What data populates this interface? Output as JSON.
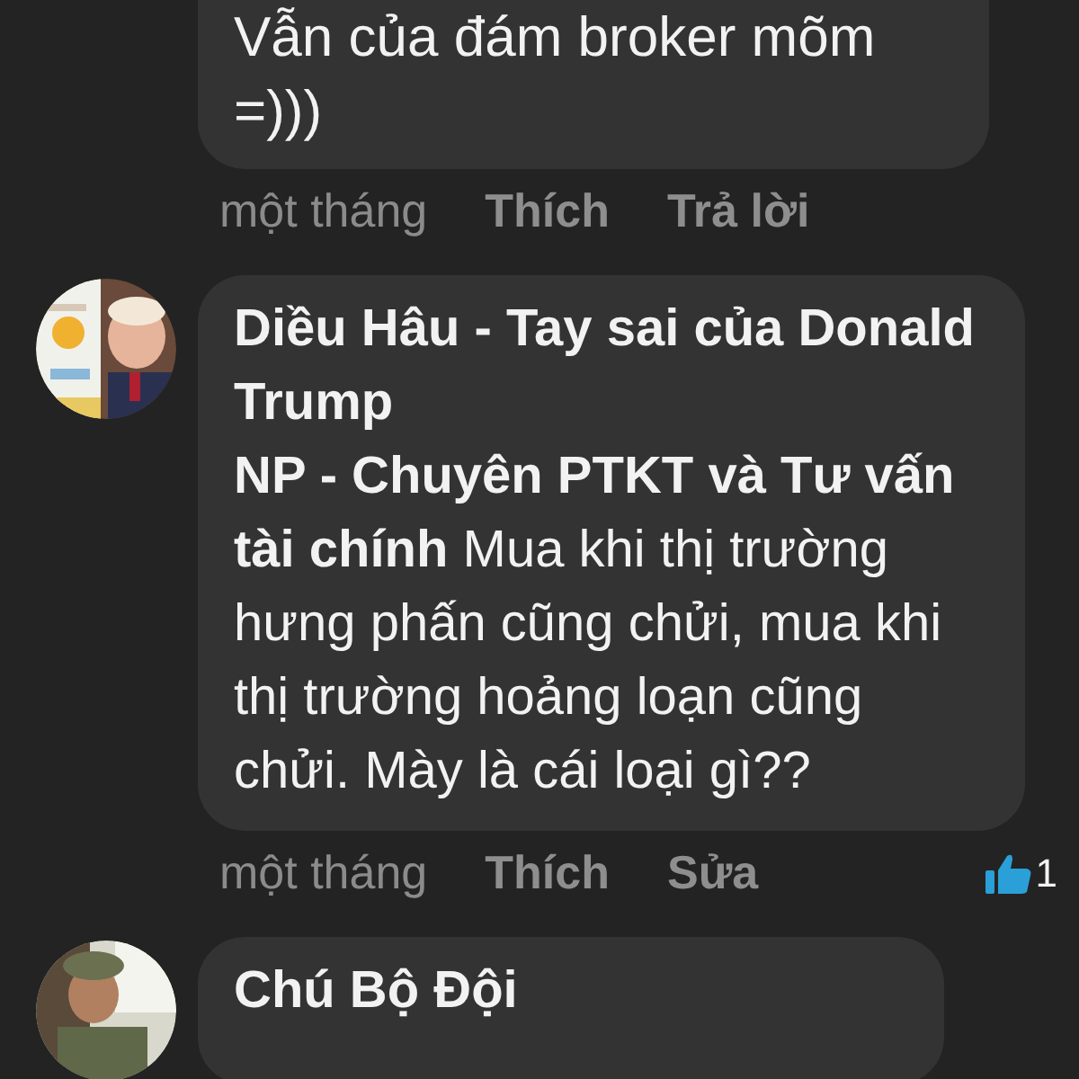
{
  "comments": [
    {
      "body": "Vẫn của đám broker mõm =)))",
      "time": "một tháng",
      "actions": [
        "Thích",
        "Trả lời"
      ]
    },
    {
      "avatar": {
        "kind": "picture"
      },
      "name": "Diều Hâu - Tay sai của Donald Trump",
      "body": "**NP - Chuyên PTKT và Tư vấn tài chính**  Mua khi thị trường hưng phấn cũng chửi, mua khi thị trường hoảng loạn cũng chửi. Mày là cái loại gì??",
      "time": "một tháng",
      "actions": [
        "Thích",
        "Sửa"
      ],
      "likes": "1"
    },
    {
      "avatar": {
        "kind": "picture"
      },
      "name": "Chú Bộ Đội"
    }
  ]
}
